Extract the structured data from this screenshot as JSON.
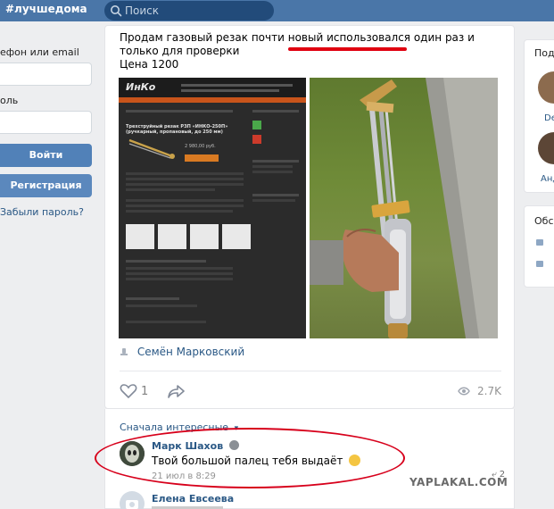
{
  "header": {
    "site_title": "#лучшедома",
    "search_placeholder": "Поиск",
    "search_icon": "search-icon"
  },
  "login": {
    "phone_label": "ефон или email",
    "password_label": "оль",
    "login_button": "Войти",
    "register_button": "Регистрация",
    "forgot_link": "Забыли пароль?"
  },
  "post": {
    "text": "Продам газовый резак почти новый использовался один раз и только для проверки",
    "price": "Цена 1200",
    "author": "Семён Марковский",
    "likes": "1",
    "views": "2.7K",
    "highlight_color": "#e00010"
  },
  "product_image": {
    "brand": "ИнКо",
    "title": "Трехструйный резак РЗП «ИНКО-250П» (ручкарный, пропановый, до 250 мм)",
    "price": "2 980,00 руб."
  },
  "comments": {
    "sort_label": "Сначала интересные",
    "items": [
      {
        "name": "Марк Шахов",
        "text": "Твой большой палец тебя выдаёт",
        "date": "21 июл в 8:29",
        "replies": "2"
      },
      {
        "name": "Елена Евсеева"
      }
    ]
  },
  "sidebar": {
    "friends_title": "Под",
    "friend_names": [
      "De",
      "Анд"
    ],
    "discussions_title": "Обсу"
  },
  "watermark": "YAPLAKAL.COM"
}
